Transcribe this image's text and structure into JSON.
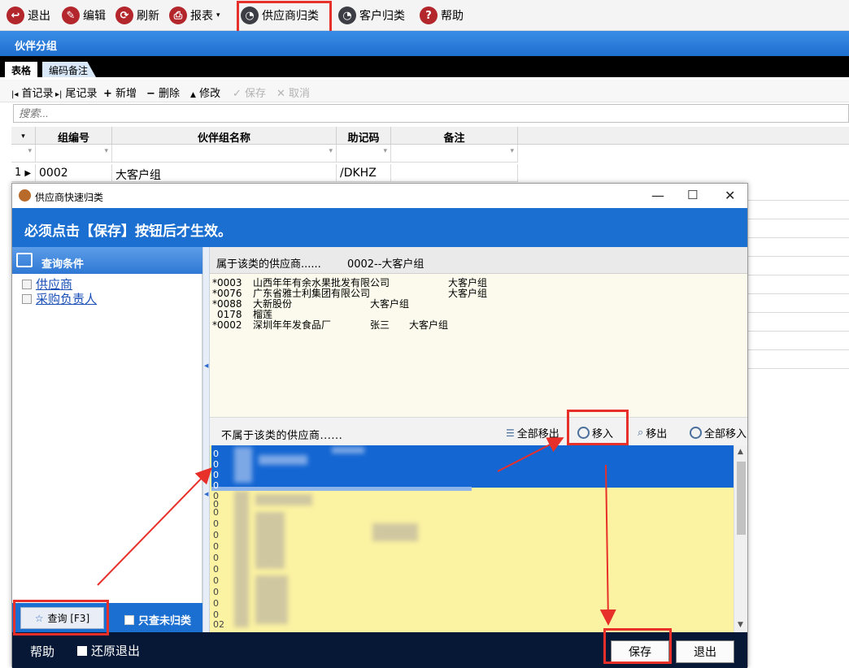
{
  "toolbar": {
    "exit": "退出",
    "edit": "编辑",
    "refresh": "刷新",
    "report": "报表",
    "supplier_classify": "供应商归类",
    "customer_classify": "客户归类",
    "help": "帮助"
  },
  "group_bar": {
    "title": "伙伴分组"
  },
  "tabs": {
    "table": "表格",
    "code_notes": "编码备注"
  },
  "record_toolbar": {
    "first": "首记录",
    "last": "尾记录",
    "add": "新增",
    "delete": "删除",
    "modify": "修改",
    "save": "保存",
    "cancel": "取消"
  },
  "search": {
    "placeholder": "搜索..."
  },
  "grid": {
    "columns": [
      "组编号",
      "伙伴组名称",
      "助记码",
      "备注"
    ],
    "rows": [
      {
        "index": "1",
        "code": "0002",
        "name": "大客户组",
        "mnemonic": "/DKHZ",
        "note": ""
      }
    ]
  },
  "dialog": {
    "title": "供应商快速归类",
    "banner": "必须点击【保存】按钮后才生效。",
    "query_panel": {
      "title": "查询条件",
      "items": [
        "供应商",
        "采购负责人"
      ],
      "query_button": "查询 [F3]",
      "only_unclassified": "只查未归类"
    },
    "belonging": {
      "label": "属于该类的供应商......",
      "group": "0002--大客户组",
      "rows": [
        {
          "mark": "*",
          "code": "0003",
          "name": "山西年年有余水果批发有限公司",
          "person": "",
          "group": "大客户组"
        },
        {
          "mark": "*",
          "code": "0076",
          "name": "广东省雅士利集团有限公司",
          "person": "",
          "group": "大客户组"
        },
        {
          "mark": "*",
          "code": "0088",
          "name": "大新股份",
          "person": "",
          "group": "大客户组"
        },
        {
          "mark": "",
          "code": "0178",
          "name": "榴莲",
          "person": "",
          "group": ""
        },
        {
          "mark": "*",
          "code": "0002",
          "name": "深圳年年发食品厂",
          "person": "张三",
          "group": "大客户组"
        }
      ]
    },
    "not_belonging": {
      "label": "不属于该类的供应商......",
      "remove_all": "全部移出",
      "move_in": "移入",
      "move_out": "移出",
      "move_all_in": "全部移入",
      "row_prefixes": [
        "0",
        "0",
        "0",
        "0",
        "0",
        "0",
        "0",
        "0",
        "0",
        "0",
        "0",
        "0",
        "0",
        "0",
        "0",
        "0",
        "0",
        "0",
        "0",
        "0",
        "0",
        "02"
      ]
    },
    "footer": {
      "help": "帮助",
      "restore_exit": "还原退出",
      "save": "保存",
      "exit": "退出"
    }
  },
  "colors": {
    "accent_blue": "#1b6fd1",
    "highlight_red": "#e8302a",
    "list_yellow": "#fbf2a2",
    "selection_blue": "#1466d2"
  }
}
